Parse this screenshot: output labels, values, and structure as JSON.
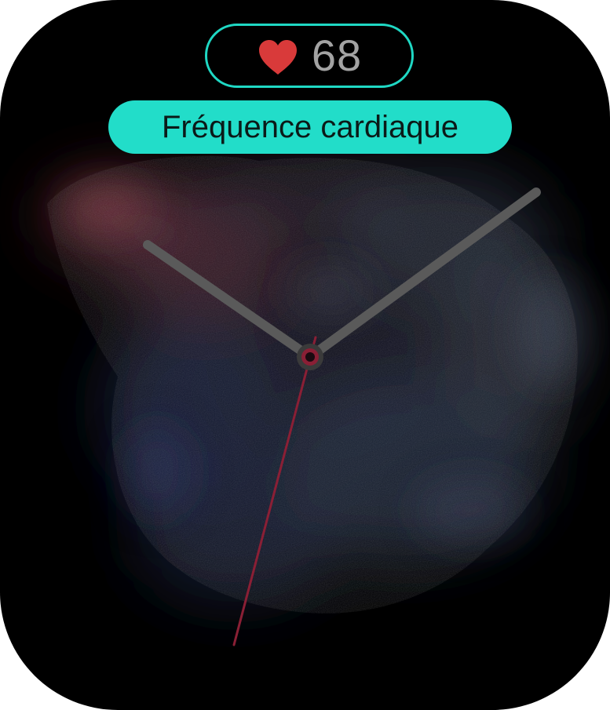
{
  "complication": {
    "icon": "heart-icon",
    "heart_color": "#d93a3a",
    "value": "68",
    "label": "Fréquence cardiaque",
    "accent_color": "#22ddc9"
  },
  "watch_face": {
    "background": "dark smoke wallpaper",
    "hands": [
      "hour-hand",
      "minute-hand",
      "second-hand"
    ],
    "hand_color": "#5a5a5a",
    "second_hand_color": "#8a1f35"
  }
}
